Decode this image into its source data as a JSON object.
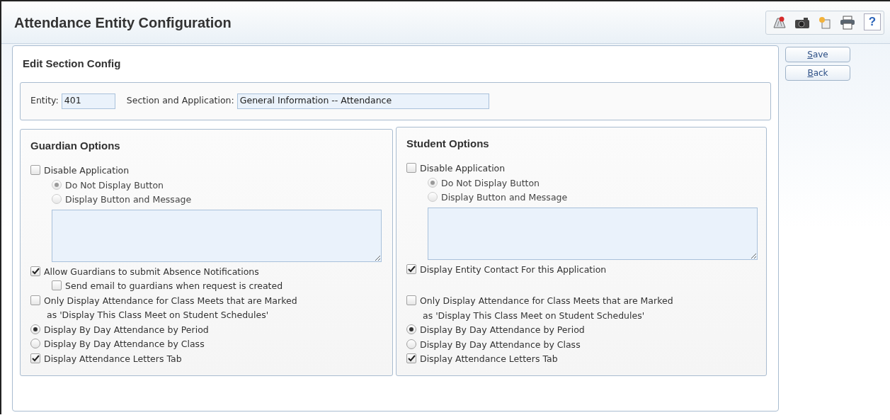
{
  "window": {
    "title": "Attendance Entity Configuration"
  },
  "toolbar": {
    "help_button": "?"
  },
  "section": {
    "title": "Edit Section Config",
    "fields": [
      {
        "label": "Entity:",
        "value": "401",
        "kind": "short"
      },
      {
        "label": "Section and Application:",
        "value": "General Information -- Attendance",
        "kind": "long"
      }
    ]
  },
  "buttons": [
    {
      "label": "Save",
      "underline_first": true
    },
    {
      "label": "Back",
      "underline_first": true
    }
  ],
  "panels": [
    {
      "title": "Guardian Options",
      "options": [
        {
          "kind": "checkbox",
          "label": "Disable Application",
          "checked": false,
          "children": [
            {
              "kind": "radio",
              "label": "Do Not Display Button",
              "selected": true,
              "disabled": true
            },
            {
              "kind": "radio",
              "label": "Display Button and Message",
              "selected": false,
              "disabled": true
            },
            {
              "kind": "textarea"
            }
          ]
        },
        {
          "kind": "checkbox",
          "label": "Allow Guardians to submit Absence Notifications",
          "checked": true,
          "children": [
            {
              "kind": "checkbox",
              "label": "Send email to guardians when request is created",
              "checked": false
            }
          ]
        },
        {
          "kind": "checkbox",
          "label": "Only Display Attendance for Class Meets that are Marked\n as 'Display This Class Meet on Student Schedules'",
          "checked": false
        },
        {
          "kind": "radio",
          "label": "Display By Day Attendance by Period",
          "selected": true,
          "disabled": false
        },
        {
          "kind": "radio",
          "label": "Display By Day Attendance by Class",
          "selected": false,
          "disabled": false
        },
        {
          "kind": "checkbox",
          "label": "Display Attendance Letters Tab",
          "checked": true
        }
      ]
    },
    {
      "title": "Student Options",
      "options": [
        {
          "kind": "checkbox",
          "label": "Disable Application",
          "checked": false,
          "children": [
            {
              "kind": "radio",
              "label": "Do Not Display Button",
              "selected": true,
              "disabled": true
            },
            {
              "kind": "radio",
              "label": "Display Button and Message",
              "selected": false,
              "disabled": true
            },
            {
              "kind": "textarea"
            }
          ]
        },
        {
          "kind": "checkbox",
          "label": "Display Entity Contact For this Application",
          "checked": true
        },
        {
          "kind": "spacer"
        },
        {
          "kind": "checkbox",
          "label": "Only Display Attendance for Class Meets that are Marked\n as 'Display This Class Meet on Student Schedules'",
          "checked": false
        },
        {
          "kind": "radio",
          "label": "Display By Day Attendance by Period",
          "selected": true,
          "disabled": false
        },
        {
          "kind": "radio",
          "label": "Display By Day Attendance by Class",
          "selected": false,
          "disabled": false
        },
        {
          "kind": "checkbox",
          "label": "Display Attendance Letters Tab",
          "checked": true
        }
      ]
    }
  ]
}
